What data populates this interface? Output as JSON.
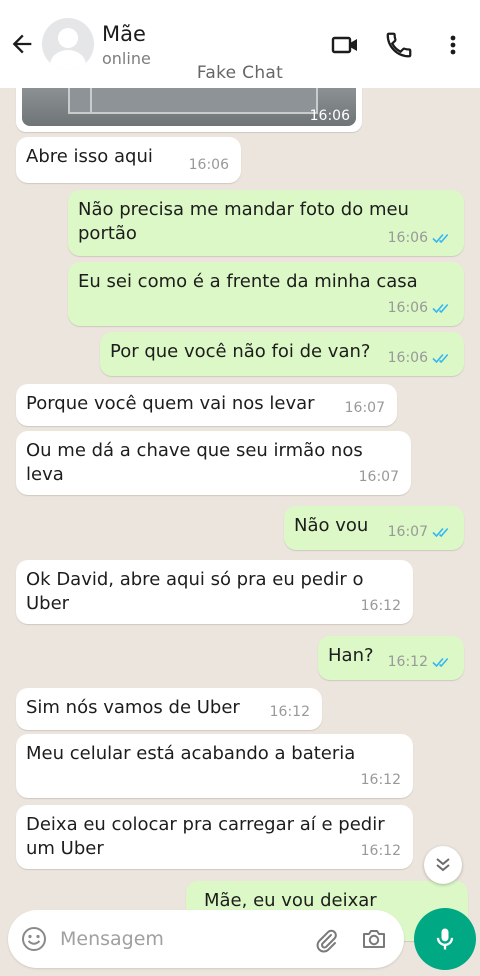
{
  "header": {
    "contact_name": "Mãe",
    "status": "online",
    "watermark": "Fake Chat",
    "icons": [
      "back-arrow-icon",
      "avatar",
      "video-call-icon",
      "phone-icon",
      "more-vert-icon"
    ]
  },
  "photo_message": {
    "time": "16:06"
  },
  "messages": [
    {
      "dir": "in",
      "text": "Abre isso aqui",
      "time": "16:06"
    },
    {
      "dir": "out",
      "text": "Não precisa me mandar foto do meu\nportão",
      "time": "16:06",
      "read": true
    },
    {
      "dir": "out",
      "text": "Eu sei como é a frente da minha casa",
      "time": "16:06",
      "read": true
    },
    {
      "dir": "out",
      "text": "Por que você não foi de van?",
      "time": "16:06",
      "read": true
    },
    {
      "dir": "in",
      "text": "Porque você quem vai nos levar",
      "time": "16:07"
    },
    {
      "dir": "in",
      "text": "Ou me dá a chave que seu irmão nos leva",
      "time": "16:07"
    },
    {
      "dir": "out",
      "text": "Não vou",
      "time": "16:07",
      "read": true
    },
    {
      "dir": "in",
      "text": "Ok David, abre aqui só pra eu pedir o\nUber",
      "time": "16:12"
    },
    {
      "dir": "out",
      "text": "Han?",
      "time": "16:12",
      "read": true
    },
    {
      "dir": "in",
      "text": "Sim nós vamos de Uber",
      "time": "16:12"
    },
    {
      "dir": "in",
      "text": "Meu celular está acabando a bateria",
      "time": "16:12"
    },
    {
      "dir": "in",
      "text": "Deixa eu colocar pra carregar aí e pedir\num Uber",
      "time": "16:12"
    },
    {
      "dir": "out",
      "text": "Mãe, eu vou deixar",
      "time": "",
      "read": false
    }
  ],
  "composer": {
    "placeholder": "Mensagem",
    "icons": [
      "emoji-icon",
      "attach-icon",
      "camera-icon",
      "mic-icon"
    ]
  },
  "colors": {
    "incoming_bubble": "#ffffff",
    "outgoing_bubble": "#dcf8c6",
    "background": "#ece5dd",
    "read_tick": "#34b7f1",
    "mic_button": "#00a884"
  }
}
